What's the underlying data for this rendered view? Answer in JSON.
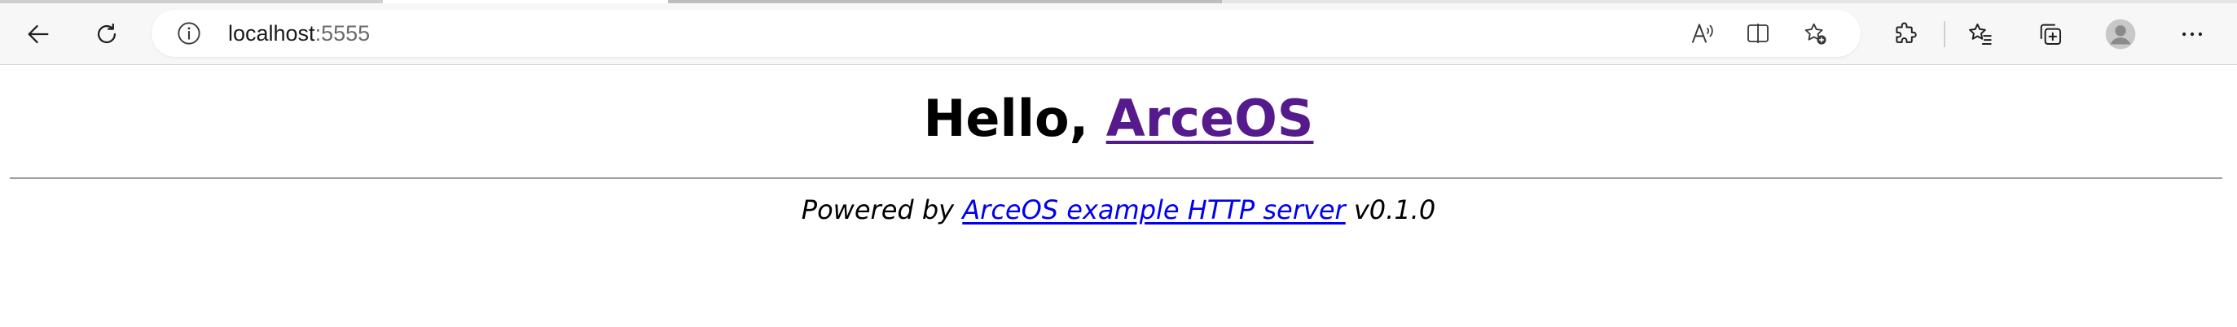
{
  "browser": {
    "url_host": "localhost",
    "url_port": ":5555",
    "back_icon": "back-arrow-icon",
    "refresh_icon": "refresh-icon",
    "site_info_icon": "info-icon",
    "read_aloud_icon": "read-aloud-icon",
    "split_screen_icon": "split-screen-icon",
    "add_favorite_icon": "add-favorite-icon",
    "extensions_icon": "puzzle-icon",
    "favorites_icon": "favorites-icon",
    "collections_icon": "collections-icon",
    "profile_icon": "profile-icon",
    "more_icon": "more-icon"
  },
  "page": {
    "heading_prefix": "Hello, ",
    "heading_link": "ArceOS",
    "footer_prefix": "Powered by ",
    "footer_link": "ArceOS example HTTP server",
    "footer_suffix": " v0.1.0"
  },
  "colors": {
    "visited_link": "#551a8b",
    "link": "#0000ee",
    "toolbar_bg": "#f7f7f7",
    "divider": "#a0a0a0"
  }
}
